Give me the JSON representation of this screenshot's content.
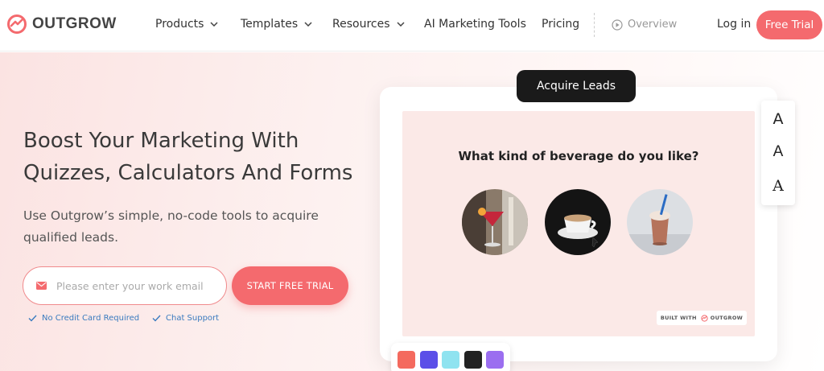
{
  "brand": {
    "name": "OUTGROW",
    "accent": "#f46a6e"
  },
  "nav": {
    "items": [
      {
        "label": "Products",
        "has_dropdown": true
      },
      {
        "label": "Templates",
        "has_dropdown": true
      },
      {
        "label": "Resources",
        "has_dropdown": true
      },
      {
        "label": "AI Marketing Tools",
        "has_dropdown": false
      },
      {
        "label": "Pricing",
        "has_dropdown": false
      }
    ],
    "overview_label": "Overview",
    "login_label": "Log in",
    "free_trial_label": "Free Trial"
  },
  "hero": {
    "headline_line1": "Boost Your Marketing With",
    "headline_line2": "Quizzes, Calculators And Forms",
    "subtext": "Use Outgrow’s simple, no-code tools to acquire qualified leads.",
    "email_placeholder": "Please enter your work email",
    "email_value": "",
    "cta_label": "START FREE TRIAL",
    "perks": [
      "No Credit Card Required",
      "Chat Support"
    ]
  },
  "demo": {
    "pill_label": "Acquire Leads",
    "question": "What kind of beverage do you like?",
    "options": [
      {
        "icon": "cocktail-image"
      },
      {
        "icon": "coffee-cup-image"
      },
      {
        "icon": "milkshake-image"
      }
    ],
    "built_with_label": "BUILT WITH",
    "built_with_brand": "OUTGROW",
    "font_options": [
      "A",
      "A",
      "A"
    ],
    "swatch_colors": [
      "#f46a5e",
      "#5b4fe8",
      "#8fe3f0",
      "#222222",
      "#9b6ef0"
    ]
  }
}
